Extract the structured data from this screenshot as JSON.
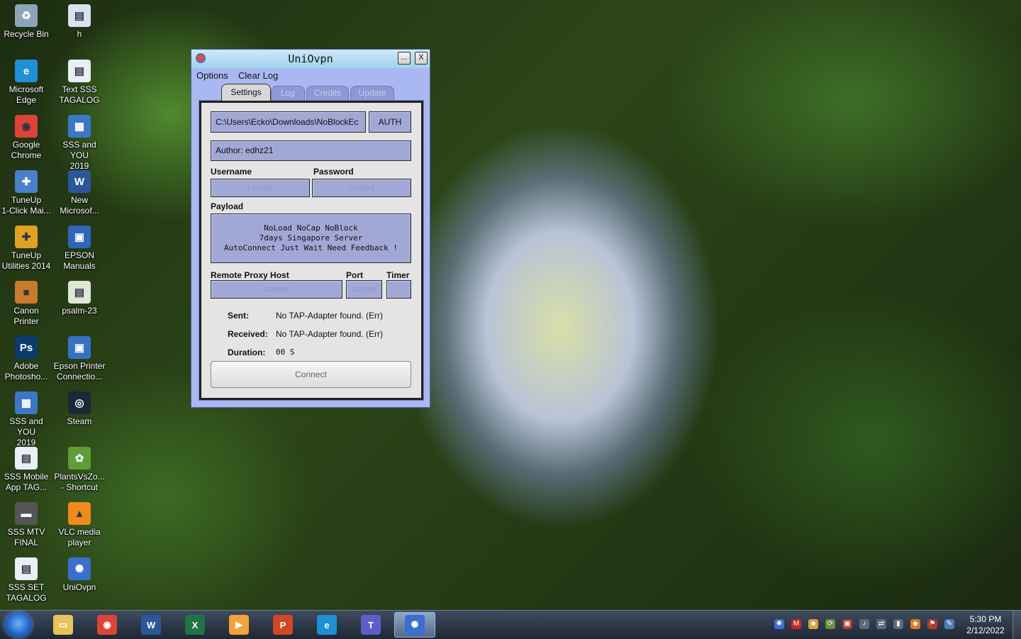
{
  "desktop": {
    "icons": [
      {
        "label_1": "Recycle Bin",
        "label_2": "",
        "icon": "recycle-bin-icon",
        "color": "#8fa4b8",
        "glyph": "♻"
      },
      {
        "label_1": "h",
        "label_2": "",
        "icon": "file-icon",
        "color": "#d7e3ee",
        "glyph": "▤"
      },
      {
        "label_1": "Microsoft",
        "label_2": "Edge",
        "icon": "edge-icon",
        "color": "#1f8fd6",
        "glyph": "e"
      },
      {
        "label_1": "Text SSS",
        "label_2": "TAGALOG",
        "icon": "document-icon",
        "color": "#e9eef7",
        "glyph": "▤"
      },
      {
        "label_1": "Google",
        "label_2": "Chrome",
        "icon": "chrome-icon",
        "color": "#db4437",
        "glyph": "◉"
      },
      {
        "label_1": "SSS and YOU",
        "label_2": "2019",
        "icon": "presentation-icon",
        "color": "#3b77c4",
        "glyph": "▦"
      },
      {
        "label_1": "TuneUp",
        "label_2": "1-Click Mai...",
        "icon": "tuneup-icon",
        "color": "#4a7fc9",
        "glyph": "✚"
      },
      {
        "label_1": "New",
        "label_2": "Microsof...",
        "icon": "word-icon",
        "color": "#2b579a",
        "glyph": "W"
      },
      {
        "label_1": "TuneUp",
        "label_2": "Utilities 2014",
        "icon": "tuneup-utilities-icon",
        "color": "#e0a222",
        "glyph": "✚"
      },
      {
        "label_1": "EPSON",
        "label_2": "Manuals",
        "icon": "epson-manual-icon",
        "color": "#2e67b8",
        "glyph": "▣"
      },
      {
        "label_1": "Canon",
        "label_2": "Printer",
        "icon": "briefcase-icon",
        "color": "#c77b2b",
        "glyph": "■"
      },
      {
        "label_1": "psalm-23",
        "label_2": "",
        "icon": "notepad-icon",
        "color": "#dfe8d4",
        "glyph": "▤"
      },
      {
        "label_1": "Adobe",
        "label_2": "Photosho...",
        "icon": "photoshop-icon",
        "color": "#0c3b6e",
        "glyph": "Ps"
      },
      {
        "label_1": "Epson Printer",
        "label_2": "Connectio...",
        "icon": "epson-connect-icon",
        "color": "#3672c2",
        "glyph": "▣"
      },
      {
        "label_1": "SSS and YOU",
        "label_2": "2019",
        "icon": "presentation-icon",
        "color": "#3b77c4",
        "glyph": "▦"
      },
      {
        "label_1": "Steam",
        "label_2": "",
        "icon": "steam-icon",
        "color": "#1b2838",
        "glyph": "◎"
      },
      {
        "label_1": "SSS Mobile",
        "label_2": "App TAG...",
        "icon": "document-icon",
        "color": "#e9eef7",
        "glyph": "▤"
      },
      {
        "label_1": "PlantsVsZo...",
        "label_2": "- Shortcut",
        "icon": "plants-icon",
        "color": "#5f9c3a",
        "glyph": "✿"
      },
      {
        "label_1": "SSS MTV",
        "label_2": "FINAL",
        "icon": "video-icon",
        "color": "#555555",
        "glyph": "▬"
      },
      {
        "label_1": "VLC media",
        "label_2": "player",
        "icon": "vlc-icon",
        "color": "#f08a1c",
        "glyph": "▲"
      },
      {
        "label_1": "SSS SET",
        "label_2": "TAGALOG",
        "icon": "document-icon",
        "color": "#e9eef7",
        "glyph": "▤"
      },
      {
        "label_1": "UniOvpn",
        "label_2": "",
        "icon": "uniovpn-icon",
        "color": "#3a6fd0",
        "glyph": "✺"
      }
    ]
  },
  "window": {
    "title": "UniOvpn",
    "minimize_label": "...",
    "close_label": "X",
    "menu": {
      "options": "Options",
      "clear_log": "Clear Log"
    },
    "tabs": [
      "Settings",
      "Log",
      "Credits",
      "Update"
    ],
    "config_path": "C:\\Users\\Ecko\\Downloads\\NoBlockEc",
    "auth_label": "AUTH",
    "author": "Author: edhz21",
    "username_label": "Username",
    "password_label": "Password",
    "username_value": "Locked",
    "password_value": "Locked",
    "payload_label": "Payload",
    "payload_lines": [
      "NoLoad NoCap NoBlock",
      "7days Singapore Server",
      "AutoConnect Just Wait Need Feedback !"
    ],
    "proxy_host_label": "Remote Proxy Host",
    "port_label": "Port",
    "timer_label": "Timer",
    "proxy_host_value": "Locked",
    "port_value": "Locked",
    "timer_value": "",
    "sent_label": "Sent:",
    "sent_value": "No TAP-Adapter found. (Err)",
    "received_label": "Received:",
    "received_value": "No TAP-Adapter found. (Err)",
    "duration_label": "Duration:",
    "duration_value": "00 S",
    "connect_label": "Connect"
  },
  "taskbar": {
    "pinned": [
      {
        "icon": "file-explorer-icon",
        "color": "#e7c35a",
        "glyph": "▭"
      },
      {
        "icon": "chrome-icon",
        "color": "#db4437",
        "glyph": "◉"
      },
      {
        "icon": "word-icon",
        "color": "#2b579a",
        "glyph": "W"
      },
      {
        "icon": "excel-icon",
        "color": "#217346",
        "glyph": "X"
      },
      {
        "icon": "media-player-icon",
        "color": "#f2a23a",
        "glyph": "▶"
      },
      {
        "icon": "powerpoint-icon",
        "color": "#d24726",
        "glyph": "P"
      },
      {
        "icon": "edge-icon",
        "color": "#1f8fd6",
        "glyph": "e"
      },
      {
        "icon": "teams-icon",
        "color": "#5b5fc7",
        "glyph": "T"
      },
      {
        "icon": "uniovpn-icon",
        "color": "#3a6fd0",
        "glyph": "✺"
      }
    ],
    "tray": [
      {
        "icon": "uniovpn-tray-icon",
        "color": "#3a6fd0",
        "glyph": "✺"
      },
      {
        "icon": "antivirus-icon",
        "color": "#c62828",
        "glyph": "M"
      },
      {
        "icon": "people-icon",
        "color": "#d9a13a",
        "glyph": "☻"
      },
      {
        "icon": "sync-icon",
        "color": "#6b8f3a",
        "glyph": "⟳"
      },
      {
        "icon": "hardware-icon",
        "color": "#b03a2e",
        "glyph": "▣"
      },
      {
        "icon": "volume-icon",
        "color": "#5b6a7c",
        "glyph": "♪"
      },
      {
        "icon": "network-icon",
        "color": "#5b6a7c",
        "glyph": "⇄"
      },
      {
        "icon": "signal-icon",
        "color": "#5b6a7c",
        "glyph": "▮"
      },
      {
        "icon": "fox-icon",
        "color": "#e0761f",
        "glyph": "◆"
      },
      {
        "icon": "action-center-flag-icon",
        "color": "#b03a2e",
        "glyph": "⚑"
      },
      {
        "icon": "tools-icon",
        "color": "#4f7fb8",
        "glyph": "✎"
      }
    ],
    "time": "5:30 PM",
    "date": "2/12/2022"
  }
}
